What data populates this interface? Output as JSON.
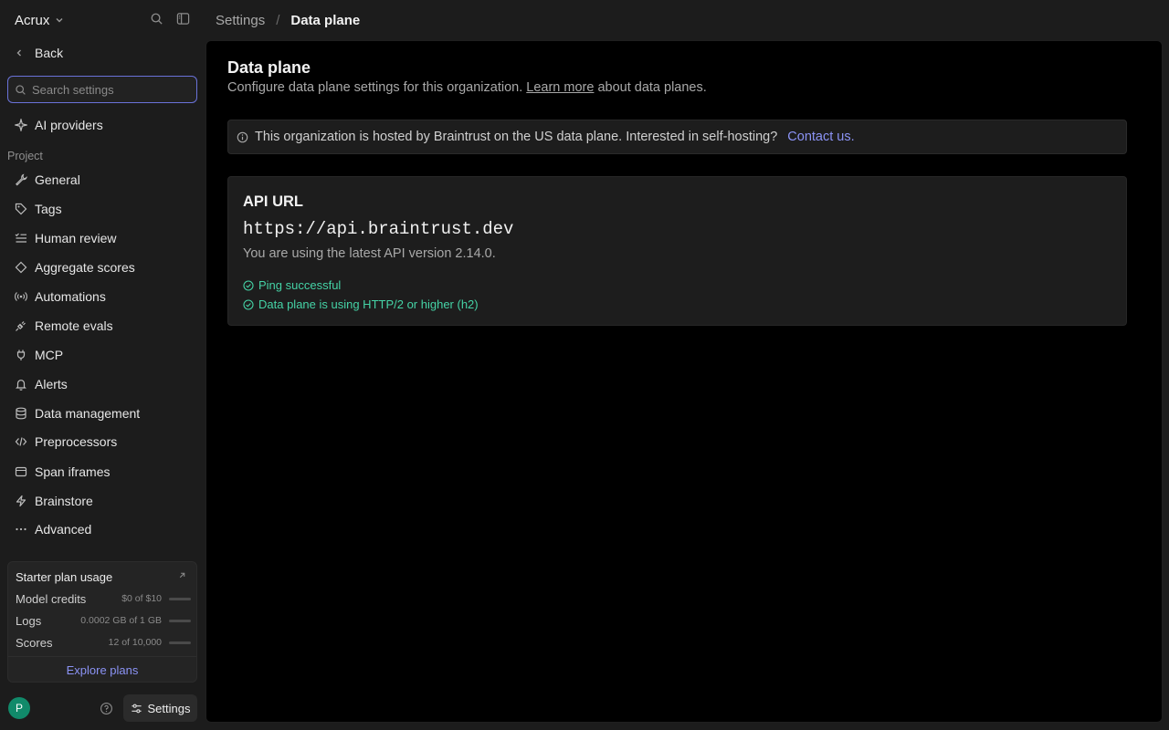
{
  "org": {
    "name": "Acrux"
  },
  "nav": {
    "back_label": "Back",
    "search_placeholder": "Search settings",
    "ai_providers_label": "AI providers",
    "project_section_label": "Project",
    "items": [
      {
        "label": "General",
        "icon": "wrench-icon"
      },
      {
        "label": "Tags",
        "icon": "tag-icon"
      },
      {
        "label": "Human review",
        "icon": "list-check-icon"
      },
      {
        "label": "Aggregate scores",
        "icon": "diamond-icon"
      },
      {
        "label": "Automations",
        "icon": "broadcast-icon"
      },
      {
        "label": "Remote evals",
        "icon": "plug-icon"
      },
      {
        "label": "MCP",
        "icon": "power-plug-icon"
      },
      {
        "label": "Alerts",
        "icon": "bell-icon"
      },
      {
        "label": "Data management",
        "icon": "database-icon"
      },
      {
        "label": "Preprocessors",
        "icon": "code-icon"
      },
      {
        "label": "Span iframes",
        "icon": "frame-icon"
      },
      {
        "label": "Brainstore",
        "icon": "bolt-icon"
      },
      {
        "label": "Advanced",
        "icon": "ellipsis-icon"
      }
    ]
  },
  "usage": {
    "title": "Starter plan usage",
    "rows": [
      {
        "label": "Model credits",
        "value": "$0 of $10",
        "fraction": 0
      },
      {
        "label": "Logs",
        "value": "0.0002 GB of 1 GB",
        "fraction": 0.0002
      },
      {
        "label": "Scores",
        "value": "12 of 10,000",
        "fraction": 0.0012
      }
    ],
    "explore_label": "Explore plans"
  },
  "footer": {
    "avatar_initial": "P",
    "settings_label": "Settings"
  },
  "breadcrumb": {
    "root": "Settings",
    "separator": "/",
    "current": "Data plane"
  },
  "page": {
    "title": "Data plane",
    "description_before": "Configure data plane settings for this organization. ",
    "description_link": "Learn more",
    "description_after": " about data planes.",
    "notice_text": "This organization is hosted by Braintrust on the US data plane. Interested in self-hosting?",
    "notice_link": "Contact us."
  },
  "api": {
    "heading": "API URL",
    "url": "https://api.braintrust.dev",
    "version_text": "You are using the latest API version 2.14.0.",
    "checks": [
      "Ping successful",
      "Data plane is using HTTP/2 or higher (h2)"
    ]
  },
  "colors": {
    "accent": "#8b93f5",
    "success": "#45d3a6",
    "avatar": "#118a6a"
  }
}
